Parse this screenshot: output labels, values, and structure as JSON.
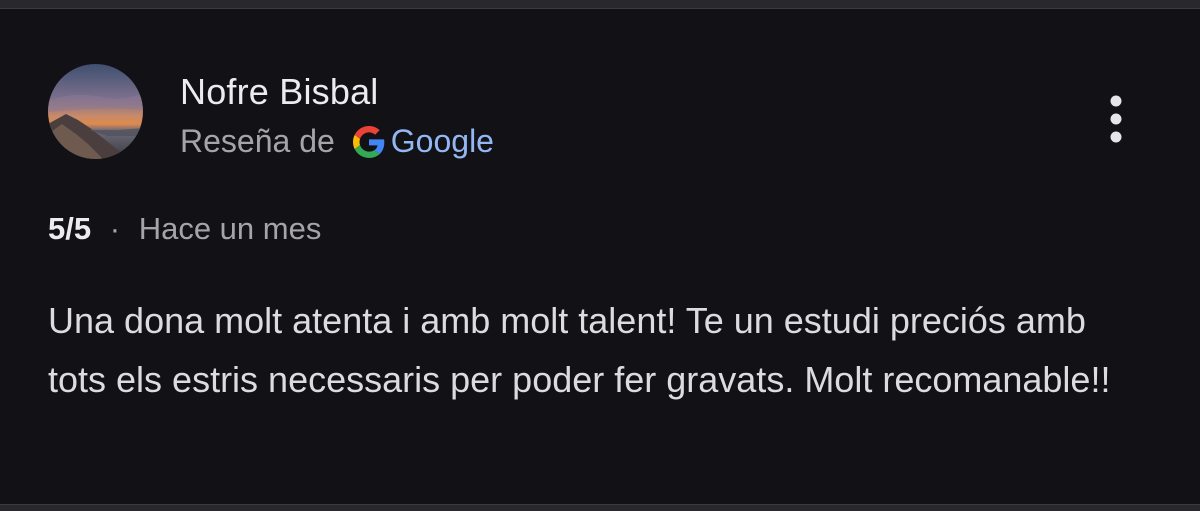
{
  "review": {
    "author_name": "Nofre Bisbal",
    "source_prefix": "Reseña de",
    "source_brand": "Google",
    "rating": "5/5",
    "separator": "·",
    "time_ago": "Hace un mes",
    "text": "Una dona molt atenta i amb molt talent! Te un estudi preciós amb tots els estris necessaris per poder fer gravats. Molt recomanable!!"
  },
  "icons": {
    "avatar": "avatar-photo-mountain-sunset",
    "brand": "google-g-icon",
    "menu": "more-vertical-icon"
  },
  "colors": {
    "card_background": "#111116",
    "primary_text": "#ececef",
    "secondary_text": "#a4a4aa",
    "link_blue": "#93b7f3"
  }
}
